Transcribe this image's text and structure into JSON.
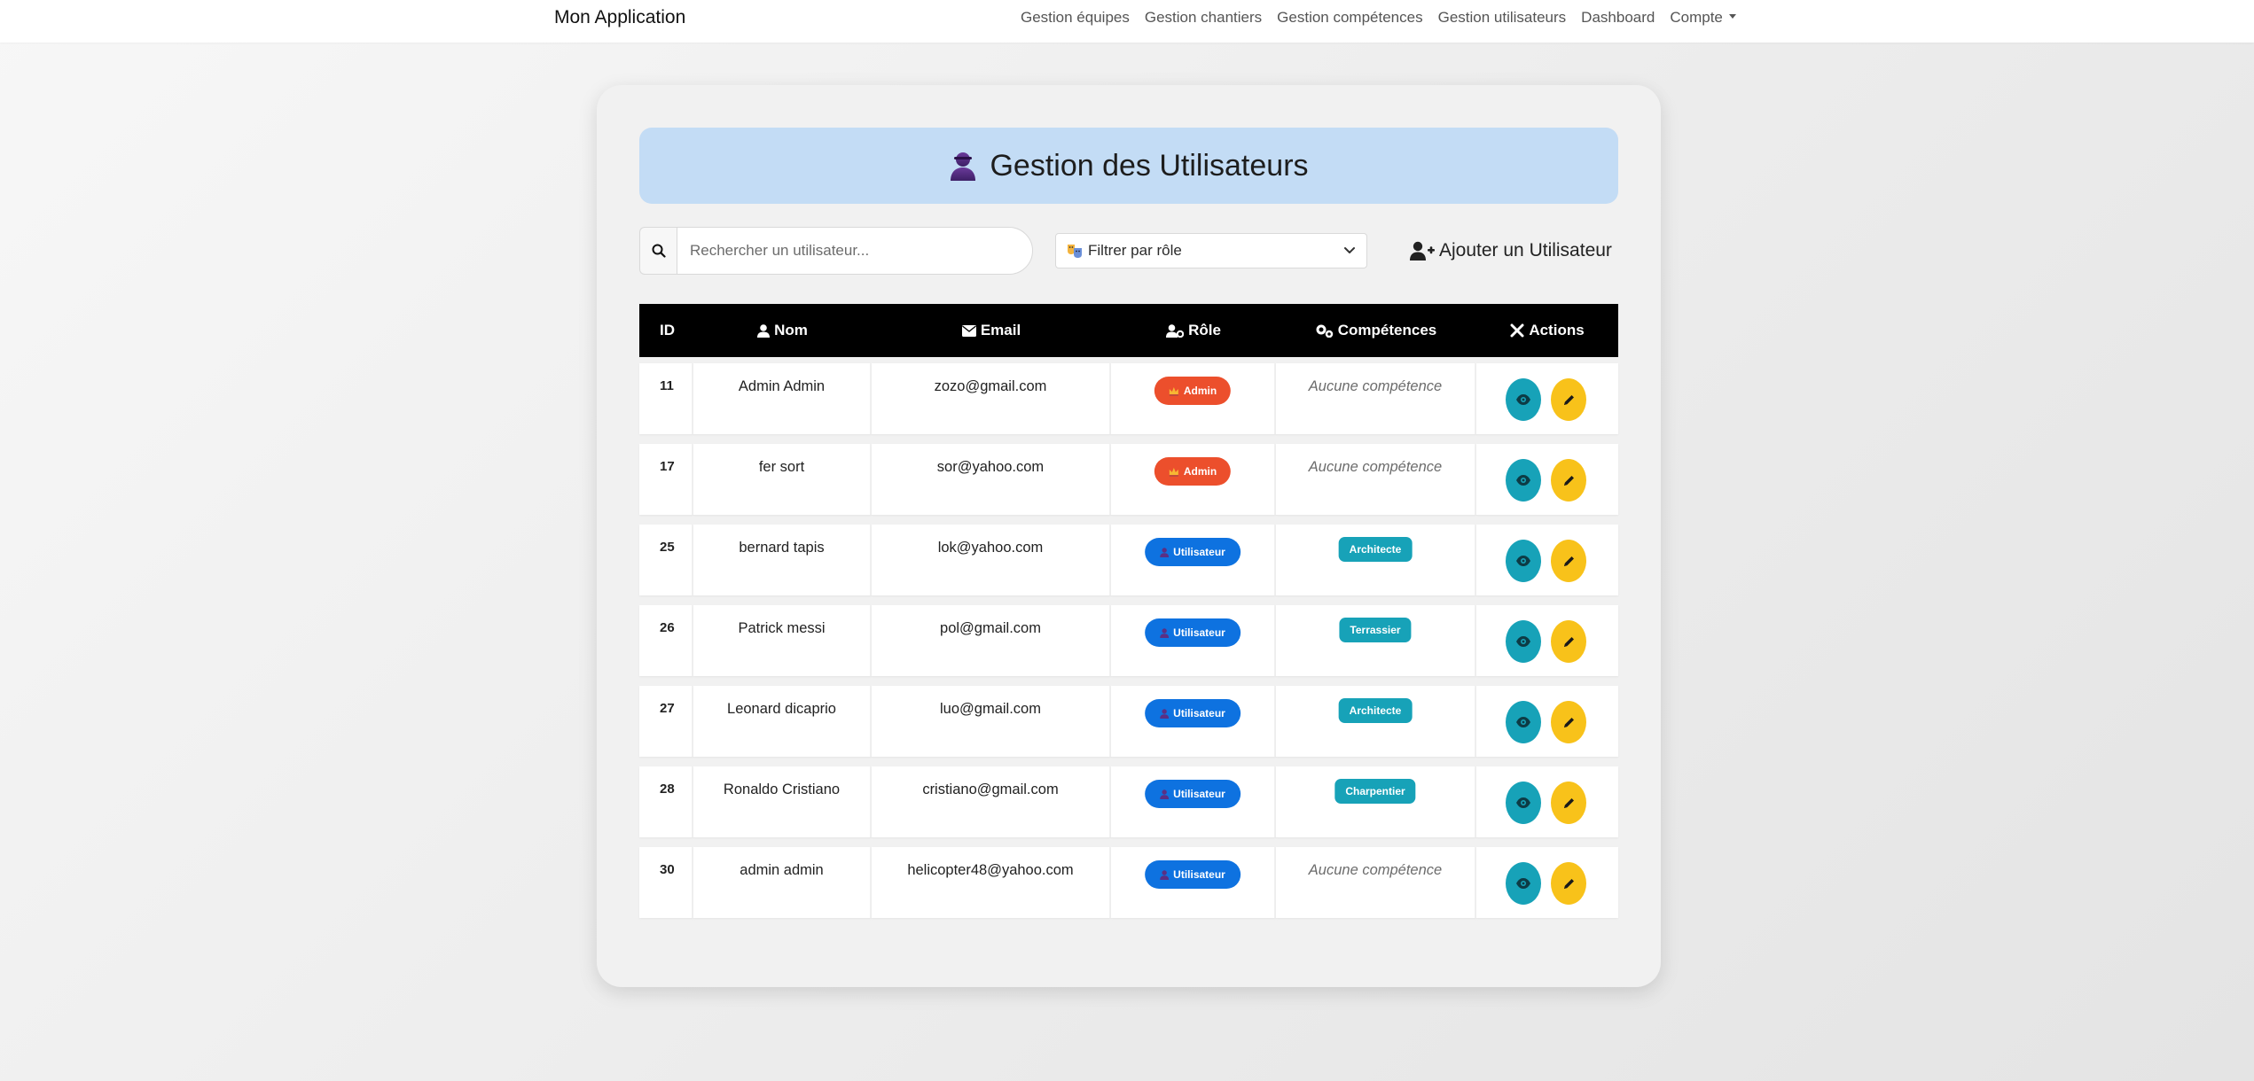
{
  "navbar": {
    "brand": "Mon Application",
    "links": [
      "Gestion équipes",
      "Gestion chantiers",
      "Gestion compétences",
      "Gestion utilisateurs",
      "Dashboard"
    ],
    "account": "Compte"
  },
  "header": {
    "title": "Gestion des Utilisateurs",
    "icon": "user-icon"
  },
  "toolbar": {
    "search_placeholder": "Rechercher un utilisateur...",
    "filter_label": "Filtrer par rôle",
    "add_label": "Ajouter un Utilisateur"
  },
  "table": {
    "headers": {
      "id": "ID",
      "nom": "Nom",
      "email": "Email",
      "role": "Rôle",
      "competences": "Compétences",
      "actions": "Actions"
    },
    "rows": [
      {
        "id": "11",
        "nom": "Admin Admin",
        "email": "zozo@gmail.com",
        "role": "Admin",
        "role_type": "admin",
        "competence": "Aucune compétence",
        "has_comp": false
      },
      {
        "id": "17",
        "nom": "fer sort",
        "email": "sor@yahoo.com",
        "role": "Admin",
        "role_type": "admin",
        "competence": "Aucune compétence",
        "has_comp": false
      },
      {
        "id": "25",
        "nom": "bernard tapis",
        "email": "lok@yahoo.com",
        "role": "Utilisateur",
        "role_type": "user",
        "competence": "Architecte",
        "has_comp": true
      },
      {
        "id": "26",
        "nom": "Patrick messi",
        "email": "pol@gmail.com",
        "role": "Utilisateur",
        "role_type": "user",
        "competence": "Terrassier",
        "has_comp": true
      },
      {
        "id": "27",
        "nom": "Leonard dicaprio",
        "email": "luo@gmail.com",
        "role": "Utilisateur",
        "role_type": "user",
        "competence": "Architecte",
        "has_comp": true
      },
      {
        "id": "28",
        "nom": "Ronaldo Cristiano",
        "email": "cristiano@gmail.com",
        "role": "Utilisateur",
        "role_type": "user",
        "competence": "Charpentier",
        "has_comp": true
      },
      {
        "id": "30",
        "nom": "admin admin",
        "email": "helicopter48@yahoo.com",
        "role": "Utilisateur",
        "role_type": "user",
        "competence": "Aucune compétence",
        "has_comp": false
      }
    ]
  },
  "colors": {
    "banner": "#c3dcf5",
    "admin_badge": "#ec4f2c",
    "user_badge": "#0e72e0",
    "competence_badge": "#17a2b8",
    "view_button": "#17a2b8",
    "edit_button": "#f8c21a",
    "table_header": "#000000"
  }
}
